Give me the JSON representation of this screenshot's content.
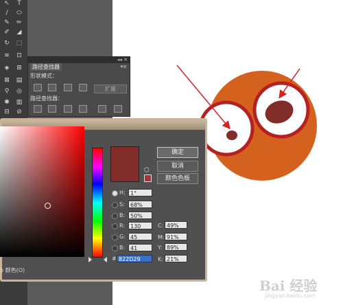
{
  "pathfinder": {
    "tab": "路径查找器",
    "shape_modes_label": "形状模式：",
    "expand_label": "扩展",
    "pathfinders_label": "路径查找器："
  },
  "color_picker": {
    "buttons": {
      "ok": "确定",
      "cancel": "取消",
      "swatches": "颜色色板"
    },
    "hsb": [
      {
        "label": "H:",
        "value": "1°",
        "selected": true
      },
      {
        "label": "S:",
        "value": "68%",
        "selected": false
      },
      {
        "label": "B:",
        "value": "50%",
        "selected": false
      }
    ],
    "rgb": [
      {
        "label": "R:",
        "value": "130"
      },
      {
        "label": "G:",
        "value": "45"
      },
      {
        "label": "B:",
        "value": "41"
      }
    ],
    "cmyk": [
      {
        "label": "C:",
        "value": "49%"
      },
      {
        "label": "M:",
        "value": "91%"
      },
      {
        "label": "Y:",
        "value": "89%"
      },
      {
        "label": "K:",
        "value": "21%"
      }
    ],
    "hex_label": "#",
    "hex_value": "822D29",
    "web_colors_label": "b 颜色(O)",
    "current_color": "#822D29"
  },
  "illustration": {
    "face_color": "#D4621E",
    "eye_ring_color": "#B52020",
    "pupil_color": "#822D29",
    "arrow_color": "#D82020"
  },
  "watermark": {
    "brand": "Bai 经验",
    "url": "jingyan.baidu.com"
  }
}
